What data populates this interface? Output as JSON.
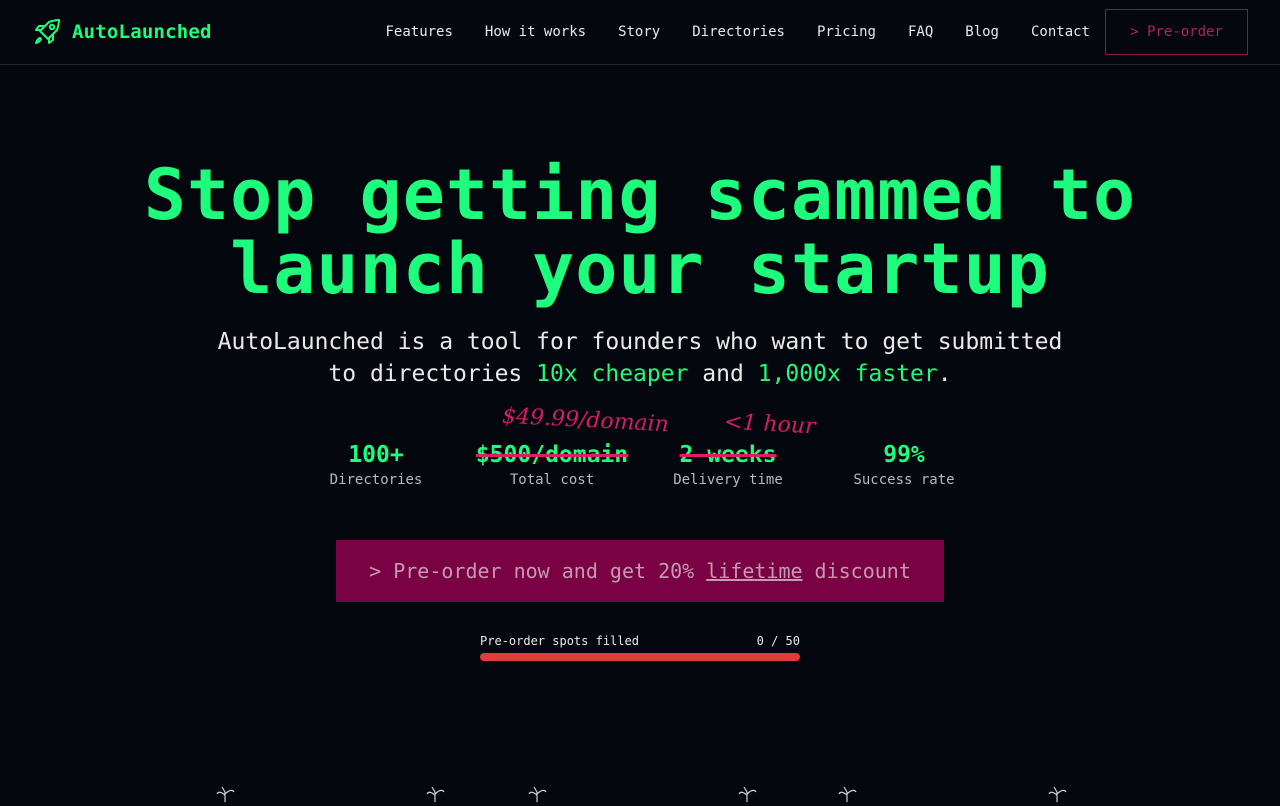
{
  "brand": {
    "name": "AutoLaunched",
    "icon": "rocket-icon"
  },
  "nav": {
    "links": [
      "Features",
      "How it works",
      "Story",
      "Directories",
      "Pricing",
      "FAQ",
      "Blog",
      "Contact"
    ],
    "preorder_label": "> Pre-order"
  },
  "hero": {
    "title_line1": "Stop getting scammed to",
    "title_line2": "launch your startup",
    "sub_part1": "AutoLaunched is a tool for founders who want to get submitted",
    "sub_part2": "to directories ",
    "sub_accent1": "10x cheaper",
    "sub_part3": " and ",
    "sub_accent2": "1,000x faster",
    "sub_part4": "."
  },
  "stats": [
    {
      "value": "100+",
      "label": "Directories"
    },
    {
      "value": "$500/domain",
      "label": "Total cost",
      "note": "$49.99/domain"
    },
    {
      "value": "2 weeks",
      "label": "Delivery time",
      "note": "<1 hour"
    },
    {
      "value": "99%",
      "label": "Success rate"
    }
  ],
  "cta": {
    "prefix": "> Pre-order now and get 20%",
    "underlined": "lifetime",
    "suffix": "discount"
  },
  "progress": {
    "label": "Pre-order spots filled",
    "count": "0 / 50",
    "filled": 0,
    "total": 50
  },
  "colors": {
    "accent": "#1dfc7d",
    "cta_bg": "#7a0144",
    "strike": "#e01a66",
    "progress_track": "#e03c3c",
    "background": "#05070f"
  }
}
